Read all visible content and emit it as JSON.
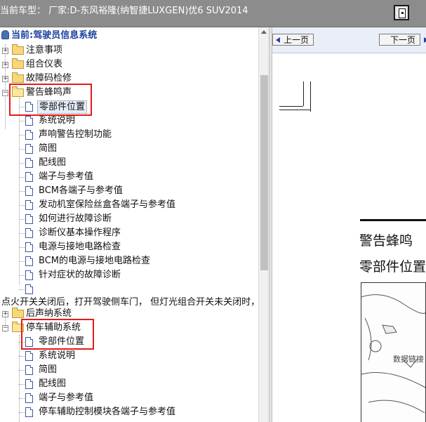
{
  "window": {
    "title": "当前车型： 厂家:D-东风裕隆(纳智捷LUXGEN)优6 SUV2014"
  },
  "tree": {
    "root_label": "当前:驾驶员信息系统",
    "nodes": [
      {
        "type": "folder",
        "label": "注意事项",
        "expander": "+"
      },
      {
        "type": "folder",
        "label": "组合仪表",
        "expander": "+"
      },
      {
        "type": "folder",
        "label": "故障码检修",
        "expander": "+"
      },
      {
        "type": "folder",
        "label": "警告蜂鸣声",
        "expander": "-",
        "open": true
      },
      {
        "type": "page",
        "label": "零部件位置",
        "selected": true
      },
      {
        "type": "page",
        "label": "系统说明"
      },
      {
        "type": "page",
        "label": "声响警告控制功能"
      },
      {
        "type": "page",
        "label": "简图"
      },
      {
        "type": "page",
        "label": "配线图"
      },
      {
        "type": "page",
        "label": "端子与参考值"
      },
      {
        "type": "page",
        "label": "BCM各端子与参考值"
      },
      {
        "type": "page",
        "label": "发动机室保险丝盒各端子与参考值"
      },
      {
        "type": "page",
        "label": "如何进行故障诊断"
      },
      {
        "type": "page",
        "label": "诊断仪基本操作程序"
      },
      {
        "type": "page",
        "label": "电源与接地电路检查"
      },
      {
        "type": "page",
        "label": "BCM的电源与接地电路检查"
      },
      {
        "type": "page",
        "label": "针对症状的故障诊断"
      },
      {
        "type": "page",
        "label": ""
      },
      {
        "type": "text",
        "label": "点火开关关闭后，打开驾驶侧车门， 但灯光组合开关未关闭时，"
      },
      {
        "type": "folder",
        "label": "后声纳系统",
        "expander": "+"
      },
      {
        "type": "folder",
        "label": "停车辅助系统",
        "expander": "-",
        "open": true
      },
      {
        "type": "page",
        "label": "零部件位置"
      },
      {
        "type": "page",
        "label": "系统说明"
      },
      {
        "type": "page",
        "label": "简图"
      },
      {
        "type": "page",
        "label": "配线图"
      },
      {
        "type": "page",
        "label": "端子与参考值"
      },
      {
        "type": "page",
        "label": "停车辅助控制模块各端子与参考值"
      }
    ]
  },
  "doc": {
    "prev_label": "上一页",
    "next_label": "下一页",
    "heading_1": "警告蜂鸣",
    "heading_2": "零部件位置",
    "figure_label": "数据链接"
  },
  "colors": {
    "titlebar_bg": "#8c8c8c",
    "highlight_box": "#e31b1b",
    "root_text": "#1a3fa0",
    "doc_toolbar_bg": "#e9eef7"
  }
}
